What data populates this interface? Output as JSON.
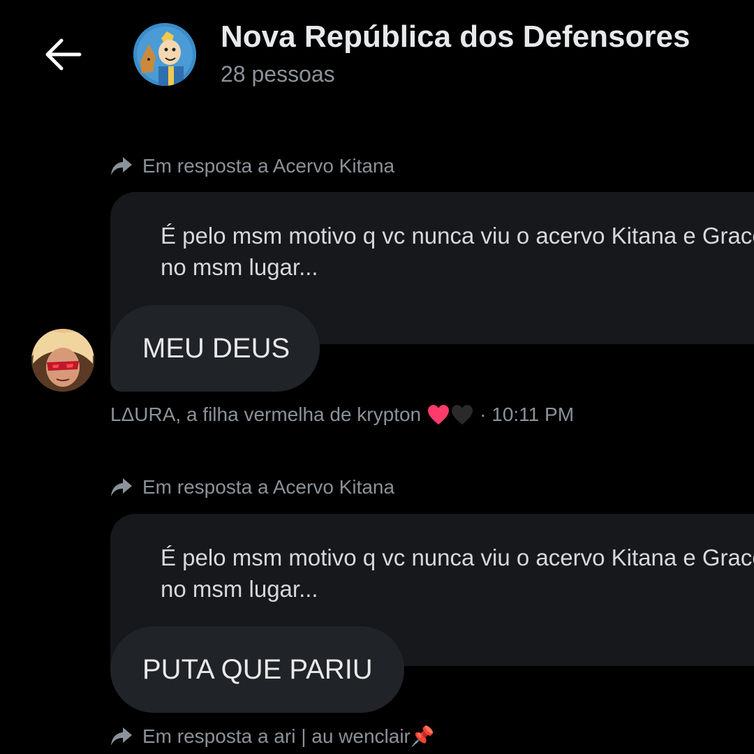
{
  "header": {
    "title": "Nova República dos Defensores",
    "subtitle": "28 pessoas"
  },
  "messages": [
    {
      "reply_to": "Em resposta a Acervo Kitana",
      "quoted_text": "É pelo msm motivo q vc nunca viu o acervo Kitana e Grace no msm lugar...",
      "text": "MEU DEUS",
      "sender": "LΔURA, a filha vermelha de krypton",
      "time": "· 10:11 PM"
    },
    {
      "reply_to": "Em resposta a Acervo Kitana",
      "quoted_text": "É pelo msm motivo q vc nunca viu o acervo Kitana e Grace no msm lugar...",
      "text": "PUTA QUE PARIU"
    },
    {
      "reply_to": "Em resposta a ari | au wenclair📌"
    }
  ],
  "icons": {
    "back": "arrow-left-icon",
    "reply": "reply-arrow-icon",
    "hearts": [
      "pink-heart-icon",
      "black-heart-icon"
    ]
  },
  "colors": {
    "background": "#000000",
    "bubble": "#202327",
    "quote": "#16181c",
    "muted_text": "#8b9299",
    "primary_text": "#e7e9ea"
  }
}
